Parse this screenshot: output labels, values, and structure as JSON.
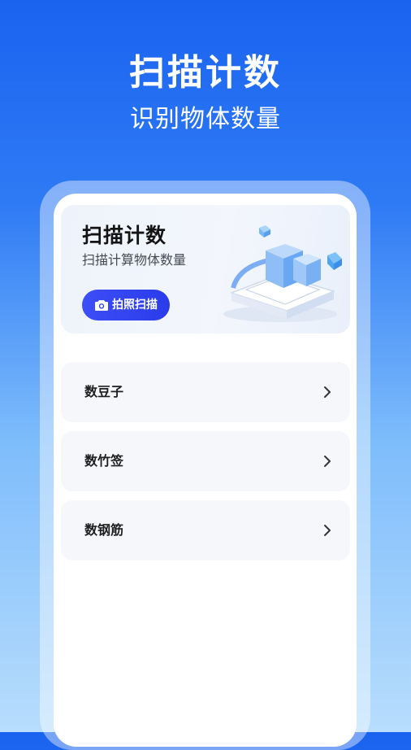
{
  "hero": {
    "title": "扫描计数",
    "subtitle": "识别物体数量"
  },
  "banner": {
    "title": "扫描计数",
    "subtitle": "扫描计算物体数量",
    "button_label": "拍照扫描",
    "button_icon": "camera-icon"
  },
  "menu": {
    "items": [
      {
        "label": "数豆子",
        "icon": "chevron-right-icon"
      },
      {
        "label": "数竹签",
        "icon": "chevron-right-icon"
      },
      {
        "label": "数钢筋",
        "icon": "chevron-right-icon"
      }
    ]
  },
  "colors": {
    "primary_blue": "#1a63f0",
    "button_blue": "#3d4ef7",
    "card_bg": "#f5f7fb"
  }
}
